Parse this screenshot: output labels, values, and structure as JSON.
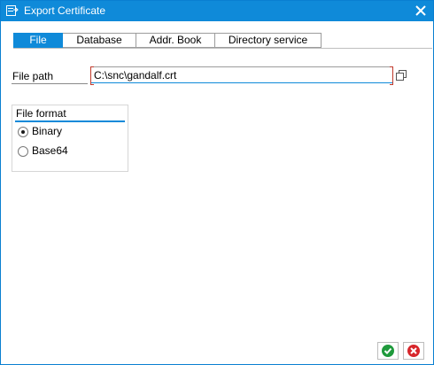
{
  "window": {
    "title": "Export Certificate",
    "title_icon": "export-dialog-icon"
  },
  "tabs": [
    {
      "label": "File",
      "active": true
    },
    {
      "label": "Database",
      "active": false
    },
    {
      "label": "Addr. Book",
      "active": false
    },
    {
      "label": "Directory service",
      "active": false
    }
  ],
  "file_path": {
    "label": "File path",
    "value": "C:\\snc\\gandalf.crt"
  },
  "file_format": {
    "title": "File format",
    "options": [
      {
        "label": "Binary",
        "selected": true
      },
      {
        "label": "Base64",
        "selected": false
      }
    ]
  },
  "colors": {
    "accent": "#0f8ad9",
    "ok": "#1f9a3c",
    "cancel": "#d7262b"
  }
}
